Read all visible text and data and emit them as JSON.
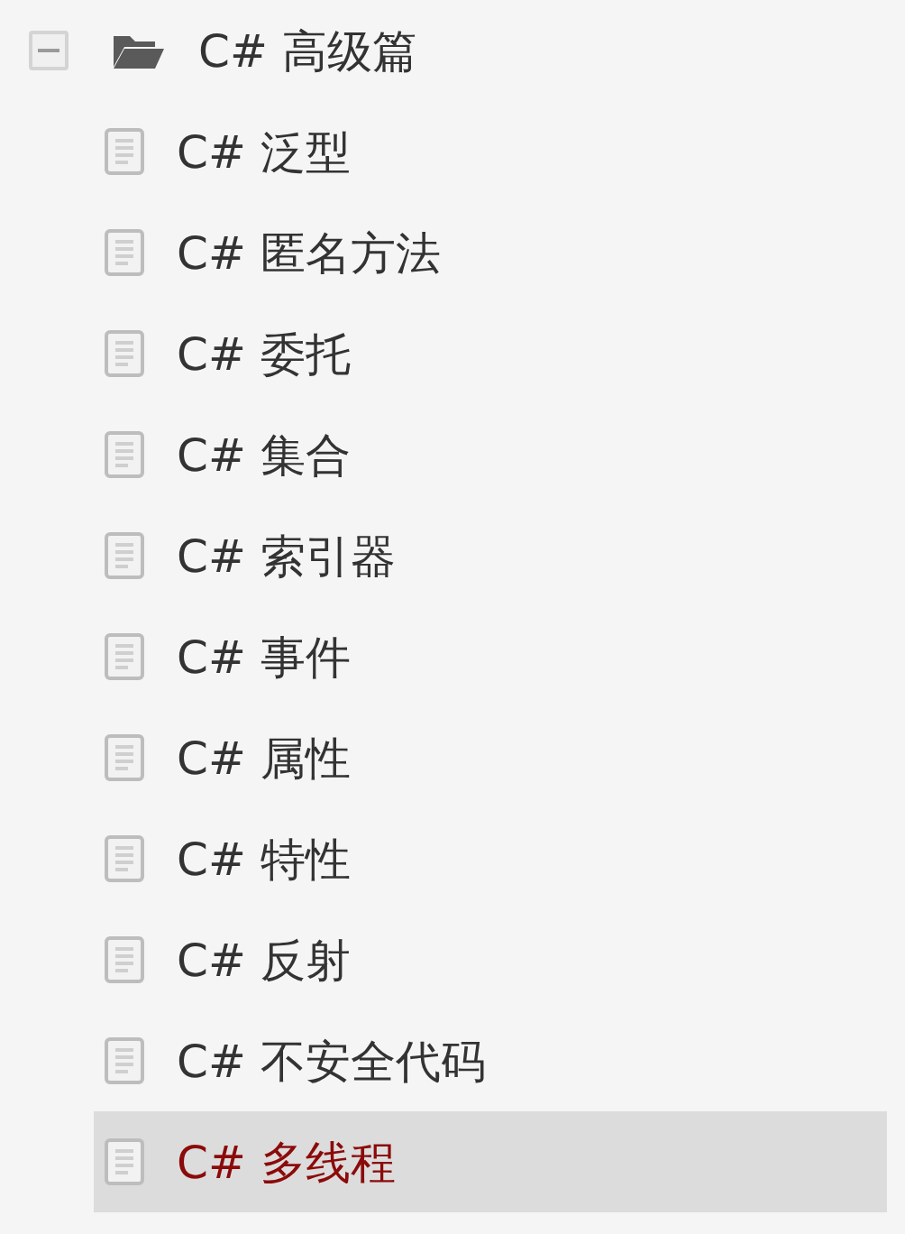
{
  "tree": {
    "label": "C# 高级篇",
    "expanded": true,
    "children": [
      {
        "label": "C# 泛型",
        "selected": false
      },
      {
        "label": "C# 匿名方法",
        "selected": false
      },
      {
        "label": "C# 委托",
        "selected": false
      },
      {
        "label": "C# 集合",
        "selected": false
      },
      {
        "label": "C# 索引器",
        "selected": false
      },
      {
        "label": "C# 事件",
        "selected": false
      },
      {
        "label": "C# 属性",
        "selected": false
      },
      {
        "label": "C# 特性",
        "selected": false
      },
      {
        "label": "C# 反射",
        "selected": false
      },
      {
        "label": "C# 不安全代码",
        "selected": false
      },
      {
        "label": "C# 多线程",
        "selected": true
      }
    ]
  }
}
